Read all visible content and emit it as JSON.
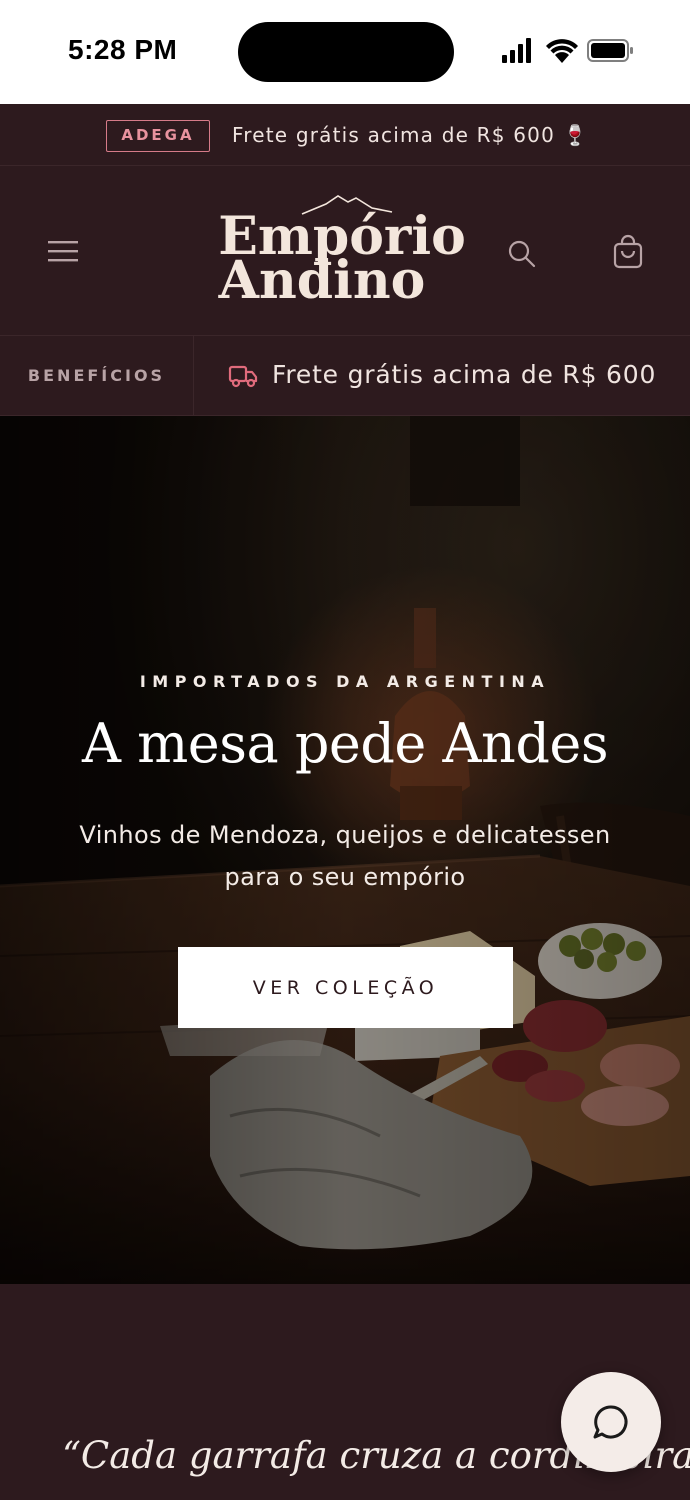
{
  "status_bar": {
    "time": "5:28 PM",
    "icons": [
      "signal-icon",
      "wifi-icon",
      "battery-icon"
    ]
  },
  "announcement": {
    "badge": "ADEGA",
    "text": "Frete grátis acima de R$ 600 🍷"
  },
  "header": {
    "logo_line1": "Empório",
    "logo_line2": "Andino",
    "icons": [
      "menu-icon",
      "search-icon",
      "cart-icon"
    ]
  },
  "benefits": {
    "label": "BENEFÍCIOS",
    "items": [
      {
        "icon": "truck-icon",
        "text": "Frete grátis acima de R$ 600"
      }
    ]
  },
  "hero": {
    "eyebrow": "IMPORTADOS DA ARGENTINA",
    "title": "A mesa pede Andes",
    "subtitle": "Vinhos de Mendoza, queijos e delicatessen para o seu empório",
    "cta": "VER COLEÇÃO"
  },
  "quote": {
    "text": "“Cada garrafa cruza a cordilheira"
  },
  "chat": {
    "icon": "chat-bubble-icon"
  },
  "colors": {
    "background": "#2d1a1e",
    "accent": "#d67b89",
    "text_light": "#f0e4e0",
    "button_bg": "#ffffff"
  }
}
